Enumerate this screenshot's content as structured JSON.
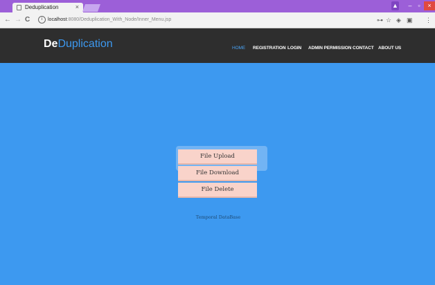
{
  "browser": {
    "tab_title": "Deduplication",
    "tab_close": "×",
    "url_host": "localhost",
    "url_path": ":8080/Deduplication_With_Node/Inner_Menu.jsp",
    "back": "←",
    "forward": "→",
    "reload": "C",
    "info": "i",
    "key_icon": "⊶",
    "star_icon": "☆",
    "ext_icon": "◈",
    "ext2_icon": "▣",
    "menu_icon": "⋮",
    "win_user": "▲",
    "win_min": "–",
    "win_max": "▫",
    "win_close": "×"
  },
  "site": {
    "logo_a": "De",
    "logo_b": "Duplication",
    "nav": [
      "HOME",
      "REGISTRATION",
      "LOGIN",
      "ADMIN PERMISSION",
      "CONTACT",
      "ABOUT US"
    ]
  },
  "main": {
    "buttons": [
      "File Upload",
      "File Download",
      "File Delete"
    ],
    "temporal_link": "Temporal DataBase"
  },
  "colors": {
    "titlebar": "#9c5fd8",
    "navbar": "#2e2e2e",
    "accent": "#3d99f0",
    "button_bg": "#f9d3ca"
  }
}
